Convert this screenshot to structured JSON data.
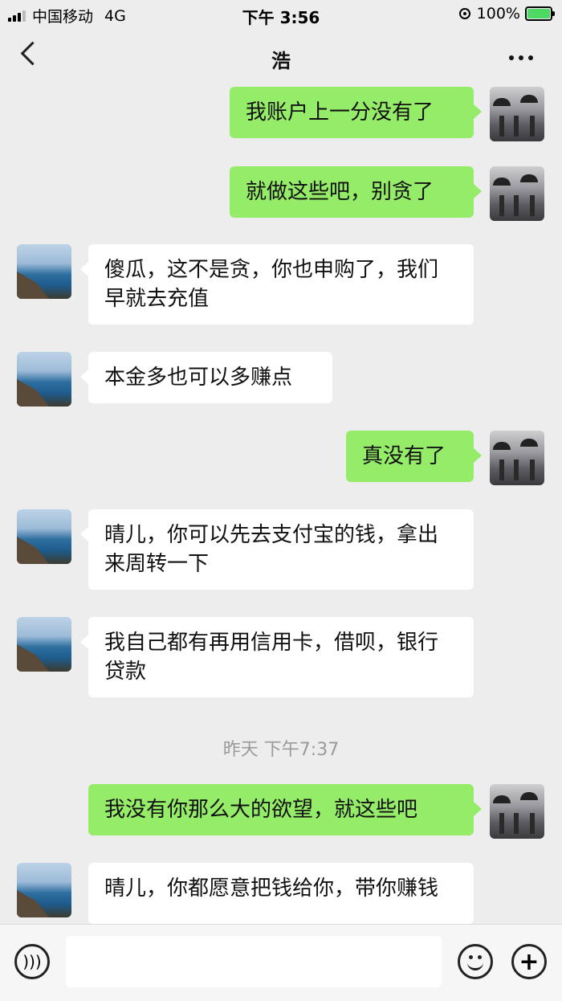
{
  "status_bar": {
    "carrier": "中国移动",
    "network": "4G",
    "time": "下午 3:56",
    "battery": "100%"
  },
  "nav": {
    "title": "浩"
  },
  "messages": [
    {
      "side": "out",
      "text": "我账户上一分没有了"
    },
    {
      "side": "out",
      "text": "就做这些吧，别贪了"
    },
    {
      "side": "in",
      "text": "傻瓜，这不是贪，你也申购了，我们早就去充值"
    },
    {
      "side": "in",
      "text": "本金多也可以多赚点"
    },
    {
      "side": "out",
      "text": "真没有了"
    },
    {
      "side": "in",
      "text": "晴儿，你可以先去支付宝的钱，拿出来周转一下"
    },
    {
      "side": "in",
      "text": "我自己都有再用信用卡，借呗，银行贷款"
    },
    {
      "side": "out",
      "text": "我没有你那么大的欲望，就这些吧"
    },
    {
      "side": "in",
      "text": "晴儿，你都愿意把钱给你，带你赚钱"
    }
  ],
  "timestamp": "昨天 下午7:37",
  "input_bar": {
    "voice_icon": "voice-icon",
    "emoji_icon": "emoji-icon",
    "plus_icon": "plus-icon"
  },
  "colors": {
    "out_bubble": "#95ec69",
    "in_bubble": "#ffffff",
    "background": "#ededed"
  }
}
